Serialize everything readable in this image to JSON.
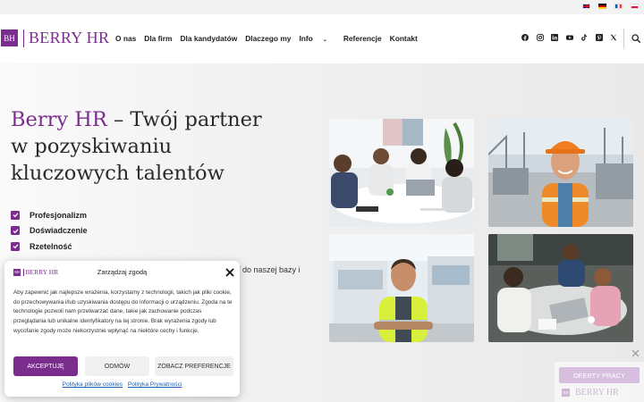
{
  "header": {
    "logo": {
      "mark": "BH",
      "text": "BERRY HR"
    },
    "languages": [
      {
        "icon": "flag-en-icon"
      },
      {
        "icon": "flag-de-icon"
      },
      {
        "icon": "flag-fr-icon"
      },
      {
        "icon": "flag-pl-icon"
      }
    ],
    "nav": [
      "O nas",
      "Dla firm",
      "Dla kandydatów",
      "Dlaczego my",
      "Info",
      "Referencje",
      "Kontakt"
    ],
    "social_icons": [
      "facebook-icon",
      "instagram-icon",
      "linkedin-icon",
      "youtube-icon",
      "tiktok-icon",
      "pinterest-icon",
      "x-icon"
    ],
    "search_icon": "search-icon"
  },
  "hero": {
    "title_accent": "Berry HR",
    "title_rest": " – Twój partner w pozyskiwaniu kluczowych talentów",
    "features": [
      "Profesjonalizm",
      "Doświadczenie",
      "Rzetelność"
    ],
    "partial_text": "/ do naszej bazy i"
  },
  "cookie": {
    "logo_mark": "BH",
    "logo_text": "BERRY HR",
    "title": "Zarządzaj zgodą",
    "body": "Aby zapewnić jak najlepsze wrażenia, korzystamy z technologii, takich jak pliki cookie, do przechowywania i/lub uzyskiwania dostępu do informacji o urządzeniu. Zgoda na te technologie pozwoli nam przetwarzać dane, takie jak zachowanie podczas przeglądania lub unikalne identyfikatory na tej stronie. Brak wyrażenia zgody lub wycofanie zgody może niekorzystnie wpłynąć na niektóre cechy i funkcje.",
    "accept": "Akceptuję",
    "deny": "Odmów",
    "preferences": "Zobacz preferencje",
    "link_cookies": "Polityka plików cookies",
    "link_privacy": "Polityka Prywatności"
  },
  "job_widget": {
    "button": "OFERTY PRACY",
    "logo_mark": "BH",
    "logo_text": "BERRY HR"
  },
  "colors": {
    "brand": "#7b2d8e",
    "link": "#1a5fb4"
  }
}
